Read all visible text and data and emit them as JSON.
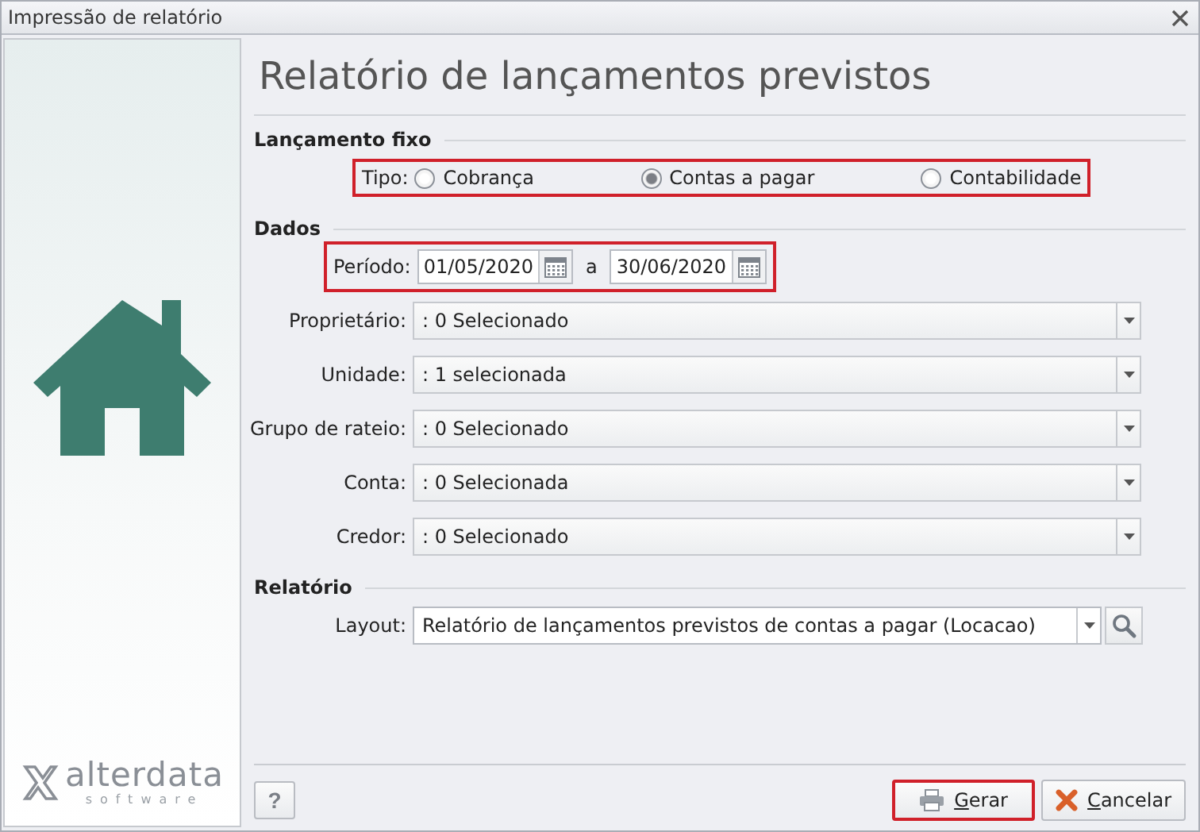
{
  "window": {
    "title": "Impressão de relatório"
  },
  "logo": {
    "name": "alterdata",
    "tagline": "software"
  },
  "heading": "Relatório de lançamentos previstos",
  "sections": [
    {
      "title": "Lançamento fixo",
      "rows": [
        {
          "kind": "radio",
          "label": "Tipo:",
          "highlighted": true,
          "options": [
            {
              "label": "Cobrança",
              "selected": false
            },
            {
              "label": "Contas a pagar",
              "selected": true
            },
            {
              "label": "Contabilidade",
              "selected": false
            }
          ]
        }
      ]
    },
    {
      "title": "Dados",
      "rows": [
        {
          "kind": "period",
          "label": "Período:",
          "highlighted": true,
          "from": "01/05/2020",
          "separator": "a",
          "to": "30/06/2020"
        },
        {
          "kind": "dropdown",
          "label": "Proprietário:",
          "value": ": 0 Selecionado"
        },
        {
          "kind": "dropdown",
          "label": "Unidade:",
          "value": ": 1 selecionada"
        },
        {
          "kind": "dropdown",
          "label": "Grupo de rateio:",
          "value": ": 0 Selecionado"
        },
        {
          "kind": "dropdown",
          "label": "Conta:",
          "value": ": 0 Selecionada"
        },
        {
          "kind": "dropdown",
          "label": "Credor:",
          "value": ": 0 Selecionado"
        }
      ]
    },
    {
      "title": "Relatório",
      "rows": [
        {
          "kind": "lookup",
          "label": "Layout:",
          "value": "Relatório de lançamentos previstos de contas a pagar (Locacao)"
        }
      ]
    }
  ],
  "help": "?",
  "buttons": [
    {
      "kind": "print",
      "label": "Gerar",
      "highlighted": true
    },
    {
      "kind": "cancel",
      "label": "Cancelar",
      "highlighted": false
    }
  ]
}
